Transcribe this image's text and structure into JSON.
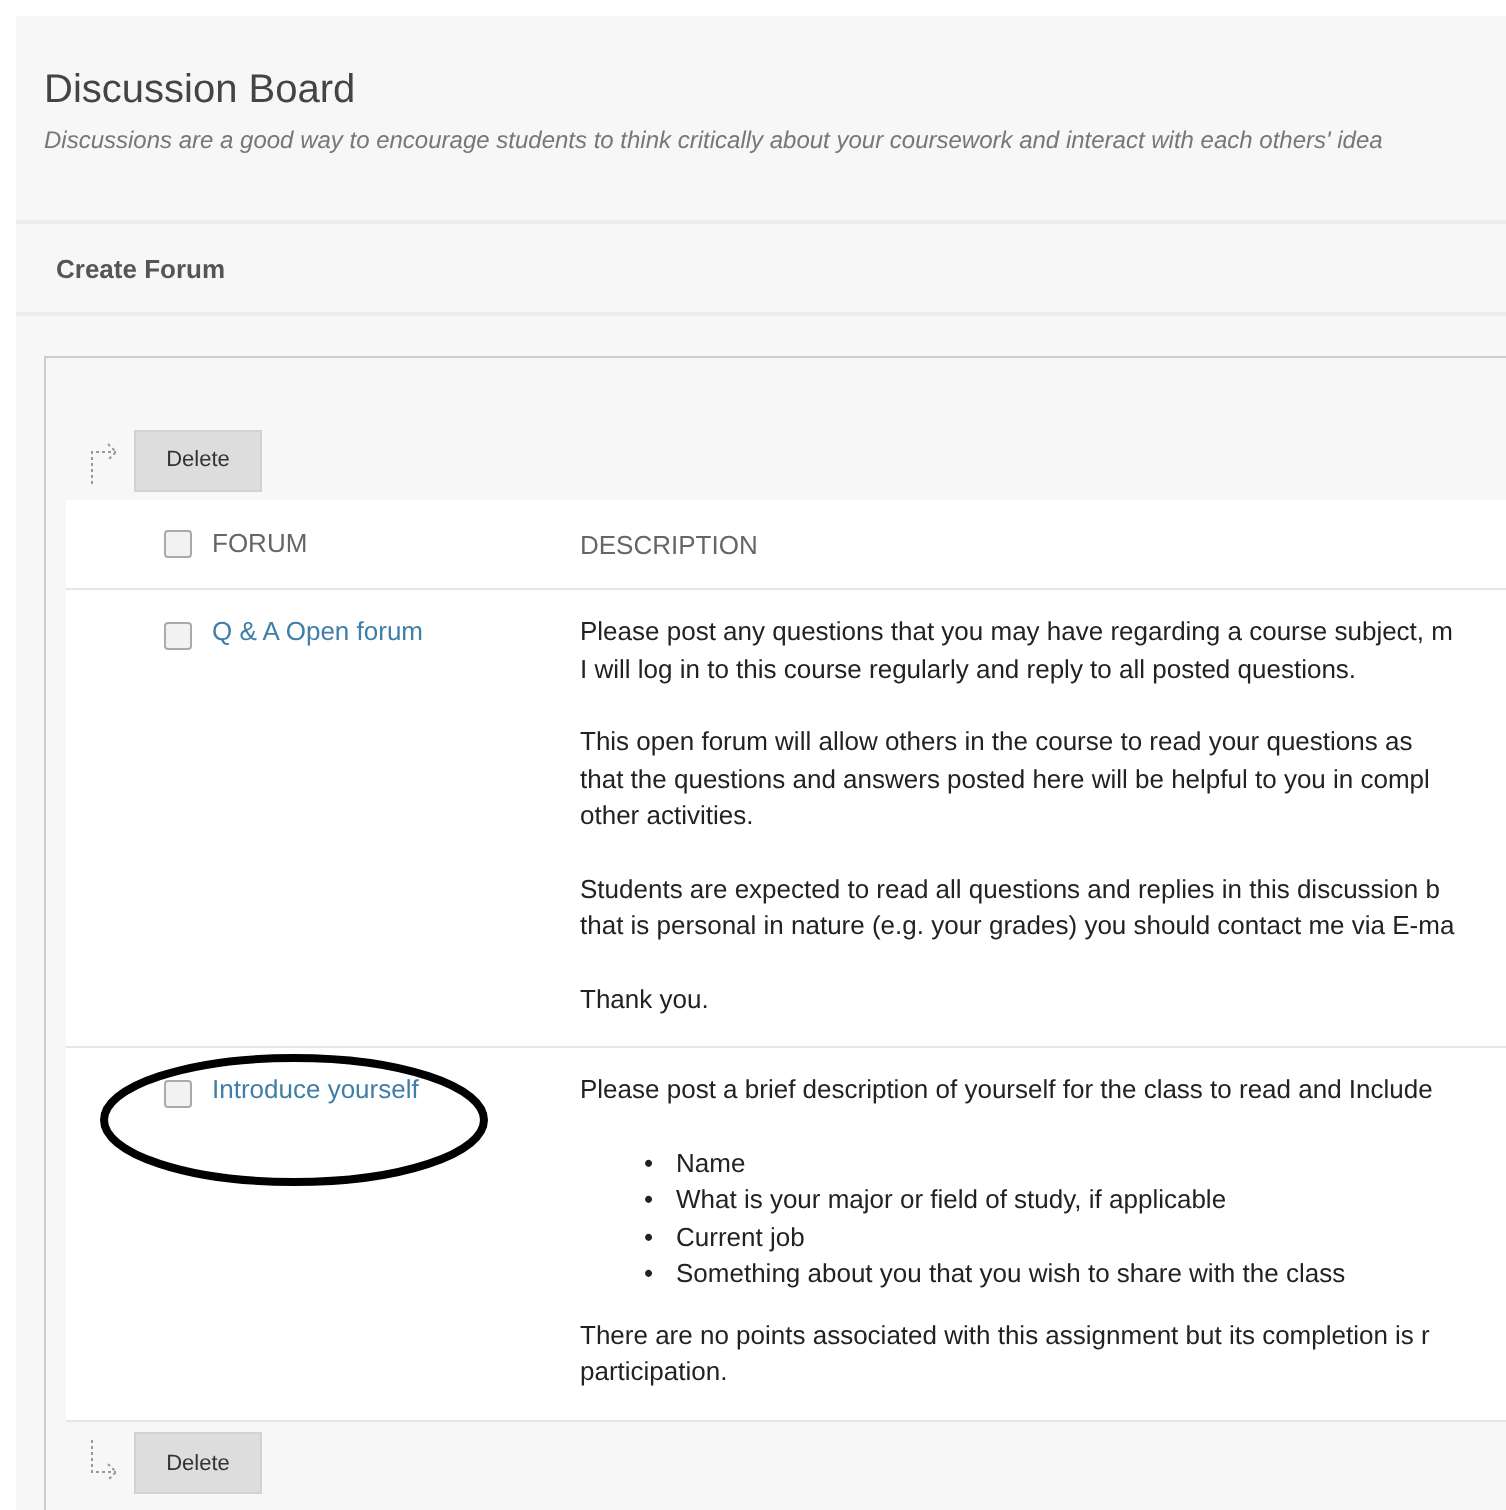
{
  "header": {
    "title": "Discussion Board",
    "description": "Discussions are a good way to encourage students to think critically about your coursework and interact with each others' idea"
  },
  "action_bar": {
    "label": "Create Forum"
  },
  "top_button": {
    "label": "Delete"
  },
  "table": {
    "header_checked": false,
    "columns": [
      "FORUM",
      "DESCRIPTION"
    ],
    "rows": [
      {
        "checked": false,
        "forum": "Q & A Open forum",
        "description": [
          {
            "kind": "paragraph",
            "lines": [
              "Please post any questions that you may have regarding a course subject, m",
              "I will log in to this course regularly and reply to all posted questions."
            ]
          },
          {
            "kind": "paragraph",
            "lines": [
              "This open forum will allow others in the course to read your questions as",
              "that the questions and answers posted here will be helpful to you in compl",
              "other activities."
            ]
          },
          {
            "kind": "paragraph",
            "lines": [
              "Students are expected to read all questions and replies in this discussion b",
              "that is personal in nature (e.g. your grades) you should contact me via E-ma"
            ]
          },
          {
            "kind": "paragraph",
            "lines": [
              "Thank you."
            ]
          }
        ]
      },
      {
        "checked": false,
        "forum": "Introduce yourself",
        "circled": true,
        "description": [
          {
            "kind": "paragraph",
            "lines": [
              "Please post a brief description of yourself for the class to read and Include"
            ]
          },
          {
            "kind": "bullets",
            "marker": "•",
            "items": [
              "Name",
              "What is your major or field of study, if applicable",
              "Current job",
              "Something about you that you wish to share with the class"
            ]
          },
          {
            "kind": "paragraph",
            "lines": [
              "There are no points associated with this assignment but its completion is r",
              "participation."
            ]
          }
        ]
      }
    ]
  },
  "bottom_button": {
    "label": "Delete"
  }
}
